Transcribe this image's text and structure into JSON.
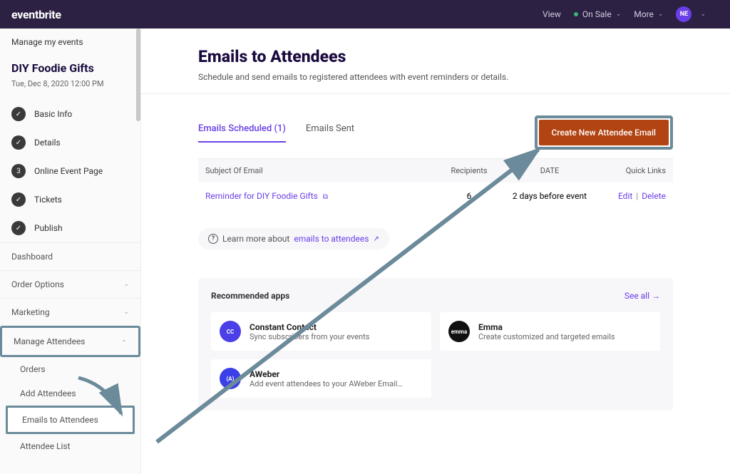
{
  "topbar": {
    "brand": "eventbrite",
    "view": "View",
    "status": "On Sale",
    "more": "More",
    "avatar": "NE"
  },
  "sidebar": {
    "manage": "Manage my events",
    "event_title": "DIY Foodie Gifts",
    "event_date": "Tue, Dec 8, 2020 12:00 PM",
    "nav": [
      {
        "label": "Basic Info",
        "icon": "✓"
      },
      {
        "label": "Details",
        "icon": "✓"
      },
      {
        "label": "Online Event Page",
        "icon": "3"
      },
      {
        "label": "Tickets",
        "icon": "✓"
      },
      {
        "label": "Publish",
        "icon": "✓"
      }
    ],
    "sections": {
      "dashboard": "Dashboard",
      "order_options": "Order Options",
      "marketing": "Marketing",
      "manage_attendees": "Manage Attendees"
    },
    "sub_items": {
      "orders": "Orders",
      "add_attendees": "Add Attendees",
      "emails_to_attendees": "Emails to Attendees",
      "attendee_list": "Attendee List"
    }
  },
  "main": {
    "title": "Emails to Attendees",
    "subtitle": "Schedule and send emails to registered attendees with event reminders or details.",
    "tabs": {
      "scheduled": "Emails Scheduled (1)",
      "sent": "Emails Sent"
    },
    "cta": "Create New Attendee Email",
    "table": {
      "headers": {
        "subject": "Subject Of Email",
        "recipients": "Recipients",
        "date": "DATE",
        "quick": "Quick Links"
      },
      "rows": [
        {
          "subject": "Reminder for DIY Foodie Gifts",
          "recipients": "6",
          "date": "2 days before event",
          "edit": "Edit",
          "delete": "Delete"
        }
      ]
    },
    "info": {
      "prefix": "Learn more about ",
      "link": "emails to attendees"
    },
    "apps": {
      "title": "Recommended apps",
      "seeall": "See all  →",
      "items": [
        {
          "name": "Constant Contact",
          "desc": "Sync subscribers from your events",
          "cls": "cc",
          "badge": "CC"
        },
        {
          "name": "Emma",
          "desc": "Create customized and targeted emails",
          "cls": "em",
          "badge": "emma"
        },
        {
          "name": "AWeber",
          "desc": "Add event attendees to your AWeber Email…",
          "cls": "aw",
          "badge": "(A)"
        }
      ]
    }
  }
}
